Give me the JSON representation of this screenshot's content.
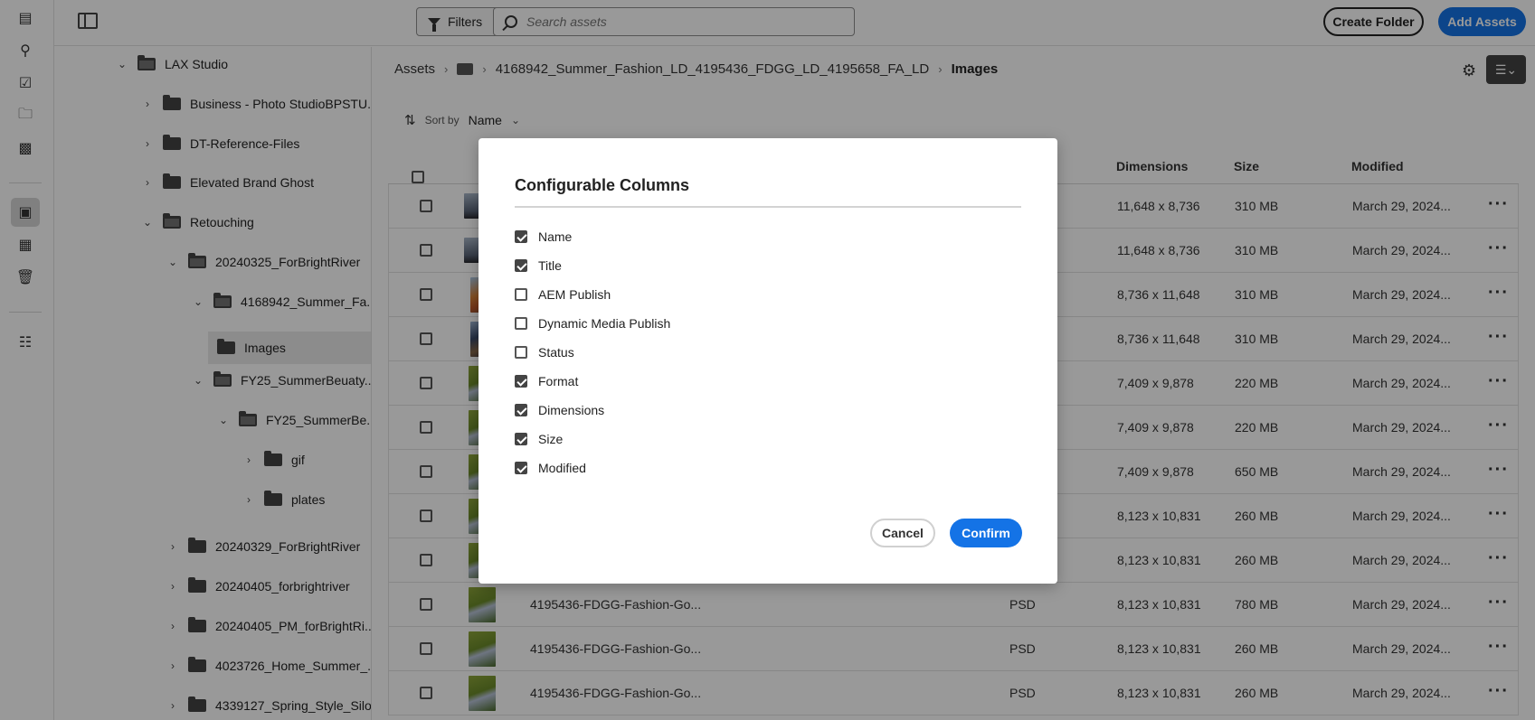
{
  "topbar": {
    "filters_label": "Filters",
    "search_placeholder": "Search assets",
    "create_folder_label": "Create Folder",
    "add_assets_label": "Add Assets"
  },
  "rail": {
    "icons": [
      "browse-icon",
      "search-icon",
      "tasks-icon",
      "collections-icon",
      "insights-icon",
      "assets-icon",
      "views-icon",
      "trash-icon",
      "reports-icon"
    ]
  },
  "tree": {
    "items": [
      {
        "label": "LAX Studio",
        "expanded": true
      },
      {
        "label": "Business - Photo StudioBPSTU...",
        "expanded": false
      },
      {
        "label": "DT-Reference-Files",
        "expanded": false
      },
      {
        "label": "Elevated Brand Ghost",
        "expanded": false
      },
      {
        "label": "Retouching",
        "expanded": true
      },
      {
        "label": "20240325_ForBrightRiver",
        "expanded": true
      },
      {
        "label": "4168942_Summer_Fa...",
        "expanded": true
      },
      {
        "label": "Images",
        "selected": true
      },
      {
        "label": "FY25_SummerBeuaty...",
        "expanded": true
      },
      {
        "label": "FY25_SummerBe...",
        "expanded": true
      },
      {
        "label": "gif",
        "expanded": false
      },
      {
        "label": "plates",
        "expanded": false
      },
      {
        "label": "20240329_ForBrightRiver",
        "expanded": false
      },
      {
        "label": "20240405_forbrightriver",
        "expanded": false
      },
      {
        "label": "20240405_PM_forBrightRi...",
        "expanded": false
      },
      {
        "label": "4023726_Home_Summer_...",
        "expanded": false
      },
      {
        "label": "4339127_Spring_Style_Silo...",
        "expanded": false
      }
    ]
  },
  "breadcrumb": {
    "root": "Assets",
    "folder": "4168942_Summer_Fashion_LD_4195436_FDGG_LD_4195658_FA_LD",
    "current": "Images"
  },
  "sort": {
    "label": "Sort by",
    "value": "Name"
  },
  "table": {
    "headers": {
      "dimensions": "Dimensions",
      "size": "Size",
      "modified": "Modified"
    },
    "rows": [
      {
        "name": "",
        "format": "",
        "dimensions": "11,648 x 8,736",
        "size": "310 MB",
        "modified": "March 29, 2024..."
      },
      {
        "name": "",
        "format": "",
        "dimensions": "11,648 x 8,736",
        "size": "310 MB",
        "modified": "March 29, 2024..."
      },
      {
        "name": "",
        "format": "",
        "dimensions": "8,736 x 11,648",
        "size": "310 MB",
        "modified": "March 29, 2024..."
      },
      {
        "name": "",
        "format": "",
        "dimensions": "8,736 x 11,648",
        "size": "310 MB",
        "modified": "March 29, 2024..."
      },
      {
        "name": "",
        "format": "",
        "dimensions": "7,409 x 9,878",
        "size": "220 MB",
        "modified": "March 29, 2024..."
      },
      {
        "name": "",
        "format": "",
        "dimensions": "7,409 x 9,878",
        "size": "220 MB",
        "modified": "March 29, 2024..."
      },
      {
        "name": "",
        "format": "",
        "dimensions": "7,409 x 9,878",
        "size": "650 MB",
        "modified": "March 29, 2024..."
      },
      {
        "name": "",
        "format": "",
        "dimensions": "8,123 x 10,831",
        "size": "260 MB",
        "modified": "March 29, 2024..."
      },
      {
        "name": "",
        "format": "",
        "dimensions": "8,123 x 10,831",
        "size": "260 MB",
        "modified": "March 29, 2024..."
      },
      {
        "name": "4195436-FDGG-Fashion-Go...",
        "format": "PSD",
        "dimensions": "8,123 x 10,831",
        "size": "780 MB",
        "modified": "March 29, 2024..."
      },
      {
        "name": "4195436-FDGG-Fashion-Go...",
        "format": "PSD",
        "dimensions": "8,123 x 10,831",
        "size": "260 MB",
        "modified": "March 29, 2024..."
      },
      {
        "name": "4195436-FDGG-Fashion-Go...",
        "format": "PSD",
        "dimensions": "8,123 x 10,831",
        "size": "260 MB",
        "modified": "March 29, 2024..."
      }
    ]
  },
  "modal": {
    "title": "Configurable Columns",
    "options": [
      {
        "label": "Name",
        "checked": true
      },
      {
        "label": "Title",
        "checked": true
      },
      {
        "label": "AEM Publish",
        "checked": false
      },
      {
        "label": "Dynamic Media Publish",
        "checked": false
      },
      {
        "label": "Status",
        "checked": false
      },
      {
        "label": "Format",
        "checked": true
      },
      {
        "label": "Dimensions",
        "checked": true
      },
      {
        "label": "Size",
        "checked": true
      },
      {
        "label": "Modified",
        "checked": true
      }
    ],
    "cancel_label": "Cancel",
    "confirm_label": "Confirm"
  }
}
